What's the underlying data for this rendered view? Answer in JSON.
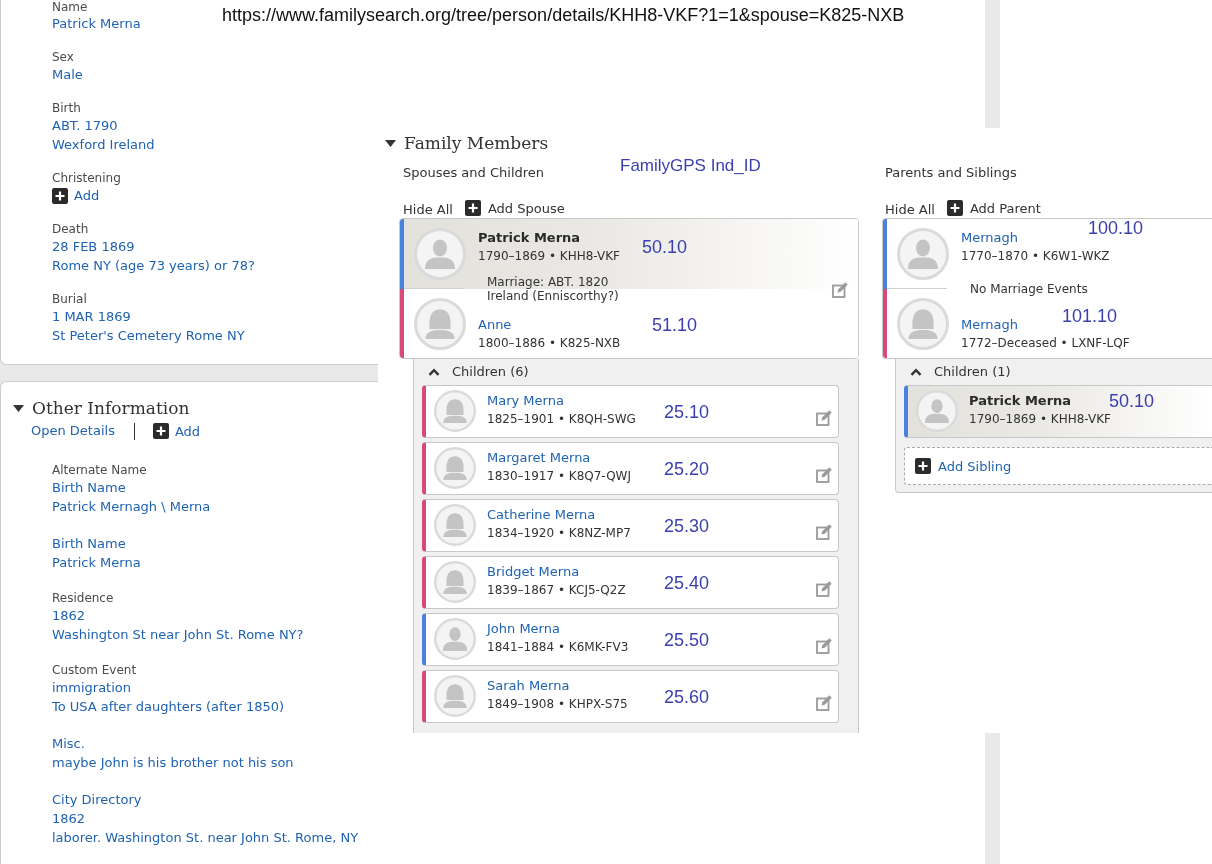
{
  "url_note": "https://www.familysearch.org/tree/person/details/KHH8-VKF?1=1&spouse=K825-NXB",
  "person_details": {
    "facts": [
      {
        "kind": "fact",
        "label": "Name",
        "values": [
          "Patrick Merna"
        ]
      },
      {
        "kind": "fact",
        "label": "Sex",
        "values": [
          "Male"
        ]
      },
      {
        "kind": "fact",
        "label": "Birth",
        "values": [
          "ABT. 1790",
          "Wexford Ireland"
        ]
      },
      {
        "kind": "add",
        "label": "Christening",
        "add_label": "Add"
      },
      {
        "kind": "fact",
        "label": "Death",
        "values": [
          "28 FEB 1869",
          "Rome NY (age 73 years) or 78?"
        ]
      },
      {
        "kind": "fact",
        "label": "Burial",
        "values": [
          "1 MAR 1869",
          "St Peter's Cemetery Rome NY"
        ]
      }
    ]
  },
  "other_information": {
    "title": "Other Information",
    "expanded": true,
    "open_details": "Open Details",
    "add_label": "Add",
    "facts": [
      {
        "label": "Alternate Name",
        "values": [
          "Birth Name",
          "Patrick Mernagh \\ Merna"
        ]
      },
      {
        "values": [
          "Birth Name",
          "Patrick Merna"
        ]
      },
      {
        "label": "Residence",
        "values": [
          "1862",
          "Washington St near John St. Rome NY?"
        ]
      },
      {
        "label": "Custom Event",
        "values": [
          "immigration",
          "To USA after daughters (after 1850)"
        ]
      },
      {
        "values": [
          "Misc.",
          "maybe John is his brother not his son"
        ]
      },
      {
        "values": [
          "City Directory",
          "1862",
          "laborer. Washington St. near John St. Rome, NY"
        ]
      }
    ]
  },
  "family_members": {
    "title": "Family Members",
    "expanded": true,
    "annotation_heading": "FamilyGPS Ind_ID",
    "columns": [
      {
        "heading": "Spouses and Children",
        "hide_all": "Hide All",
        "add_label": "Add Spouse",
        "edit_icons": true,
        "couple": {
          "persons": [
            {
              "kind": "male",
              "name": "Patrick Merna",
              "dates": "1790–1869 • KHH8-VKF",
              "current": true,
              "ind_id": "50.10"
            },
            {
              "kind": "female",
              "name": "Anne",
              "dates": "1800–1886 • K825-NXB",
              "current": false,
              "ind_id": "51.10"
            }
          ],
          "marriage": [
            "Marriage: ABT. 1820",
            "Ireland (Enniscorthy?)"
          ]
        },
        "children": {
          "label": "Children (6)",
          "expanded": true,
          "items": [
            {
              "kind": "female",
              "name": "Mary Merna",
              "dates": "1825–1901 • K8QH-SWG",
              "current": false,
              "ind_id": "25.10"
            },
            {
              "kind": "female",
              "name": "Margaret Merna",
              "dates": "1830–1917 • K8Q7-QWJ",
              "current": false,
              "ind_id": "25.20"
            },
            {
              "kind": "female",
              "name": "Catherine Merna",
              "dates": "1834–1920 • K8NZ-MP7",
              "current": false,
              "ind_id": "25.30"
            },
            {
              "kind": "female",
              "name": "Bridget Merna",
              "dates": "1839–1867 • KCJ5-Q2Z",
              "current": false,
              "ind_id": "25.40"
            },
            {
              "kind": "male",
              "name": "John Merna",
              "dates": "1841–1884 • K6MK-FV3",
              "current": false,
              "ind_id": "25.50"
            },
            {
              "kind": "female",
              "name": "Sarah Merna",
              "dates": "1849–1908 • KHPX-S75",
              "current": false,
              "ind_id": "25.60"
            }
          ]
        }
      },
      {
        "heading": "Parents and Siblings",
        "hide_all": "Hide All",
        "add_label": "Add Parent",
        "edit_icons": false,
        "couple": {
          "persons": [
            {
              "kind": "male",
              "name": "Mernagh",
              "dates": "1770–1870 • K6W1-WKZ",
              "current": false,
              "ind_id": "100.10"
            },
            {
              "kind": "female",
              "name": "Mernagh",
              "dates": "1772–Deceased • LXNF-LQF",
              "current": false,
              "ind_id": "101.10"
            }
          ],
          "marriage": [
            "No Marriage Events"
          ]
        },
        "children": {
          "label": "Children (1)",
          "expanded": true,
          "items": [
            {
              "kind": "male",
              "name": "Patrick Merna",
              "dates": "1790–1869 • KHH8-VKF",
              "current": true,
              "ind_id": "50.10"
            }
          ],
          "add_sibling": "Add Sibling"
        }
      }
    ]
  }
}
